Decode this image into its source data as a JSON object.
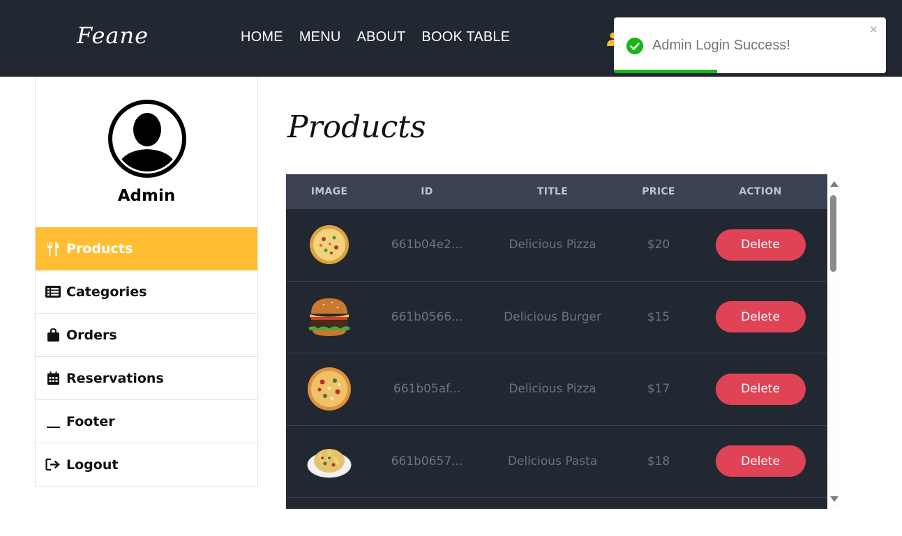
{
  "header": {
    "logo": "Feane",
    "nav": [
      "HOME",
      "MENU",
      "ABOUT",
      "BOOK TABLE"
    ],
    "accent": "#ffbe33"
  },
  "toast": {
    "message": "Admin Login Success!",
    "close": "×",
    "progress": 0.38,
    "color": "#17b617"
  },
  "sidebar": {
    "admin_name": "Admin",
    "items": [
      {
        "label": "Products",
        "icon": "utensils-icon",
        "active": true
      },
      {
        "label": "Categories",
        "icon": "list-icon",
        "active": false
      },
      {
        "label": "Orders",
        "icon": "shopping-bag-icon",
        "active": false
      },
      {
        "label": "Reservations",
        "icon": "calendar-icon",
        "active": false
      },
      {
        "label": "Footer",
        "icon": "underscore-icon",
        "active": false
      },
      {
        "label": "Logout",
        "icon": "sign-out-icon",
        "active": false
      }
    ]
  },
  "main": {
    "title": "Products",
    "table": {
      "headers": [
        "IMAGE",
        "ID",
        "TITLE",
        "PRICE",
        "ACTION"
      ],
      "rows": [
        {
          "image": "pizza-image",
          "id": "661b04e2...",
          "title": "Delicious Pizza",
          "price": "$20",
          "action": "Delete"
        },
        {
          "image": "burger-image",
          "id": "661b0566...",
          "title": "Delicious Burger",
          "price": "$15",
          "action": "Delete"
        },
        {
          "image": "pizza-image",
          "id": "661b05af...",
          "title": "Delicious Pizza",
          "price": "$17",
          "action": "Delete"
        },
        {
          "image": "pasta-image",
          "id": "661b0657...",
          "title": "Delicious Pasta",
          "price": "$18",
          "action": "Delete"
        }
      ]
    }
  }
}
